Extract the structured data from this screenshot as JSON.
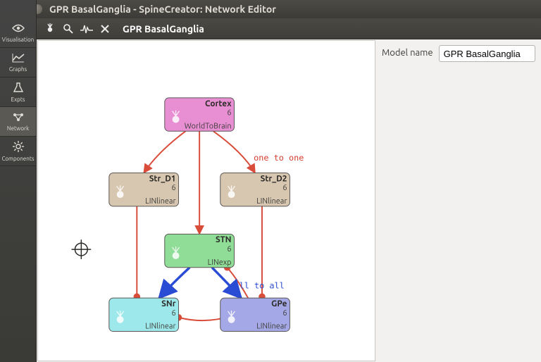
{
  "window": {
    "title": "GPR BasalGanglia - SpineCreator: Network Editor"
  },
  "toolbar": {
    "title": "GPR BasalGanglia"
  },
  "sidebar": {
    "items": [
      {
        "label": "Visualisation"
      },
      {
        "label": "Graphs"
      },
      {
        "label": "Expts"
      },
      {
        "label": "Network"
      },
      {
        "label": "Components"
      }
    ],
    "active_index": 3
  },
  "properties": {
    "model_name_label": "Model name",
    "model_name_value": "GPR BasalGanglia"
  },
  "colors": {
    "cortex": "#e88fd3",
    "str": "#d8c7b0",
    "stn": "#8fdd97",
    "snr": "#9de8ea",
    "gpe": "#a4a8e6",
    "edge_red": "#d94c3a",
    "edge_blue": "#2a4bd3"
  },
  "nodes": {
    "cortex": {
      "title": "Cortex",
      "count": "6",
      "sub": "WorldToBrain"
    },
    "str_d1": {
      "title": "Str_D1",
      "count": "6",
      "sub": "LINlinear"
    },
    "str_d2": {
      "title": "Str_D2",
      "count": "6",
      "sub": "LINlinear"
    },
    "stn": {
      "title": "STN",
      "count": "6",
      "sub": "LINexp"
    },
    "snr": {
      "title": "SNr",
      "count": "6",
      "sub": "LINlinear"
    },
    "gpe": {
      "title": "GPe",
      "count": "6",
      "sub": "LINlinear"
    }
  },
  "edge_labels": {
    "one_to_one": "one to one",
    "all_to_all": "all to all"
  }
}
